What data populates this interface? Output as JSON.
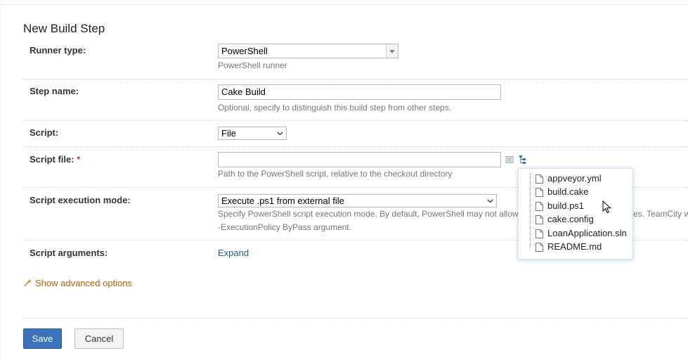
{
  "page": {
    "title": "New Build Step"
  },
  "runner": {
    "label": "Runner type:",
    "value": "PowerShell",
    "note": "PowerShell runner"
  },
  "step_name": {
    "label": "Step name:",
    "value": "Cake Build",
    "note": "Optional, specify to distinguish this build step from other steps."
  },
  "script": {
    "label": "Script:",
    "value": "File"
  },
  "script_file": {
    "label": "Script file:",
    "required_mark": "*",
    "value": "",
    "note": "Path to the PowerShell script, relative to the checkout directory",
    "icons": [
      "list-icon",
      "file-tree-icon"
    ]
  },
  "exec_mode": {
    "label": "Script execution mode:",
    "value": "Execute .ps1 from external file",
    "note_line1": "Specify PowerShell script execution mode. By default, PowerShell may not allow",
    "note_line1_tail": "es. TeamCity w",
    "note_line2": "-ExecutionPolicy ByPass argument."
  },
  "script_args": {
    "label": "Script arguments:",
    "link": "Expand"
  },
  "advanced": {
    "icon": "wrench-icon",
    "label": "Show advanced options"
  },
  "buttons": {
    "save": "Save",
    "cancel": "Cancel"
  },
  "file_popup": {
    "items": [
      "appveyor.yml",
      "build.cake",
      "build.ps1",
      "cake.config",
      "LoanApplication.sln",
      "README.md"
    ]
  },
  "colors": {
    "link": "#1a5e9c",
    "advanced": "#b56100",
    "save_button": "#3a72bd",
    "required": "#c0392b"
  }
}
